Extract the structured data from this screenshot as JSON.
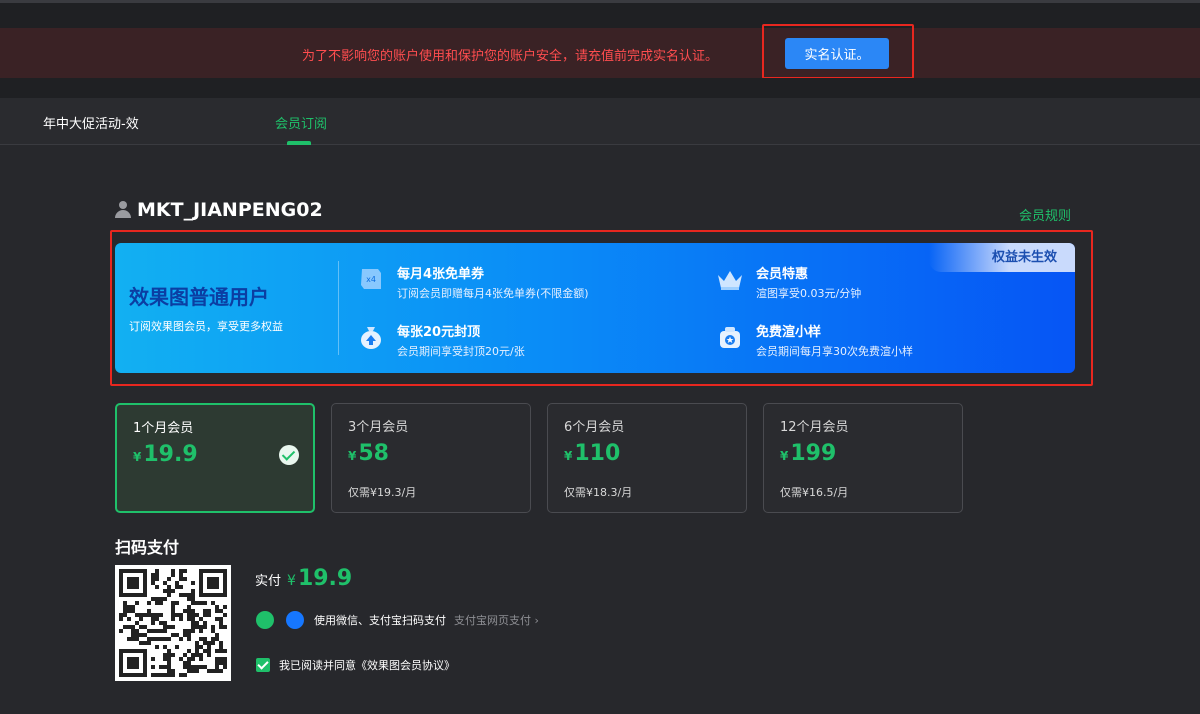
{
  "banner": {
    "message": "为了不影响您的账户使用和保护您的账户安全，请充值前完成实名认证。",
    "verify_button": "实名认证。"
  },
  "tabs": [
    {
      "label": "年中大促活动-效",
      "active": false
    },
    {
      "label": "会员订阅",
      "active": true
    }
  ],
  "user": {
    "name": "MKT_JIANPENG02",
    "rules_link": "会员规则"
  },
  "benefits": {
    "badge": "权益未生效",
    "title": "效果图普通用户",
    "subtitle": "订阅效果图会员，享受更多权益",
    "perks": [
      {
        "title": "每月4张免单券",
        "desc": "订阅会员即赠每月4张免单券(不限金额)",
        "icon": "coupon-icon"
      },
      {
        "title": "会员特惠",
        "desc": "渲图享受0.03元/分钟",
        "icon": "crown-icon"
      },
      {
        "title": "每张20元封顶",
        "desc": "会员期间享受封顶20元/张",
        "icon": "money-bag-icon"
      },
      {
        "title": "免费渲小样",
        "desc": "会员期间每月享30次免费渲小样",
        "icon": "gift-icon"
      }
    ]
  },
  "currency": "¥",
  "plans": [
    {
      "name": "1个月会员",
      "price": "19.9",
      "per": "",
      "selected": true
    },
    {
      "name": "3个月会员",
      "price": "58",
      "per": "仅需¥19.3/月",
      "selected": false
    },
    {
      "name": "6个月会员",
      "price": "110",
      "per": "仅需¥18.3/月",
      "selected": false
    },
    {
      "name": "12个月会员",
      "price": "199",
      "per": "仅需¥16.5/月",
      "selected": false
    }
  ],
  "payment": {
    "title": "扫码支付",
    "actual_label": "实付",
    "actual_amount": "19.9",
    "methods_text": "使用微信、支付宝扫码支付",
    "alipay_web_link": "支付宝网页支付",
    "agree_text": "我已阅读并同意《效果图会员协议》"
  }
}
